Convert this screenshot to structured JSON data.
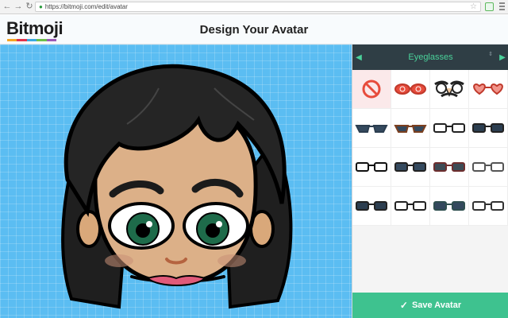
{
  "browser": {
    "url": "https://bitmoji.com/edit/avatar",
    "back_icon": "←",
    "forward_icon": "→",
    "reload_icon": "↻",
    "star_icon": "☆"
  },
  "app": {
    "logo": "Bitmoji",
    "logo_colors": [
      "#f5a623",
      "#e2324b",
      "#3aa9e0",
      "#6cc04a",
      "#9b59b6"
    ],
    "page_title": "Design Your Avatar"
  },
  "panel": {
    "category": "Eyeglasses",
    "prev_icon": "◀",
    "next_icon": "▶",
    "updown_icon": "⇕",
    "options": [
      {
        "name": "none",
        "style": "none"
      },
      {
        "name": "red-swirl",
        "style": "swirl",
        "frame": "#c0392b",
        "lens": "#e74c3c"
      },
      {
        "name": "groucho",
        "style": "groucho",
        "frame": "#222222",
        "lens": "#ffffff"
      },
      {
        "name": "heart",
        "style": "heart",
        "frame": "#c0392b",
        "lens": "#f1948a"
      },
      {
        "name": "cat-eye-dark",
        "style": "cateye",
        "frame": "#2c3e50",
        "lens": "#34495e"
      },
      {
        "name": "cat-eye-brown",
        "style": "cateye",
        "frame": "#7b3f1f",
        "lens": "#34495e"
      },
      {
        "name": "clear-thin",
        "style": "rect",
        "frame": "#222222",
        "lens": "#ffffff"
      },
      {
        "name": "dark-rect",
        "style": "rect",
        "frame": "#222222",
        "lens": "#2c3e50"
      },
      {
        "name": "clear-black",
        "style": "rect",
        "frame": "#111111",
        "lens": "#ffffff"
      },
      {
        "name": "tint-dark",
        "style": "rect",
        "frame": "#222222",
        "lens": "#34495e"
      },
      {
        "name": "tint-brown",
        "style": "rect",
        "frame": "#6d2e2e",
        "lens": "#3d4b55"
      },
      {
        "name": "clear-silver",
        "style": "rect",
        "frame": "#555555",
        "lens": "#ffffff"
      },
      {
        "name": "shades-black",
        "style": "rect",
        "frame": "#222222",
        "lens": "#2c3e50"
      },
      {
        "name": "clear-rim",
        "style": "rect",
        "frame": "#222222",
        "lens": "#ffffff"
      },
      {
        "name": "tint-teal",
        "style": "rect",
        "frame": "#2f4f4f",
        "lens": "#34495e"
      },
      {
        "name": "clear-grey",
        "style": "rect",
        "frame": "#333333",
        "lens": "#ffffff"
      }
    ],
    "save_label": "Save Avatar",
    "save_icon": "✓"
  }
}
